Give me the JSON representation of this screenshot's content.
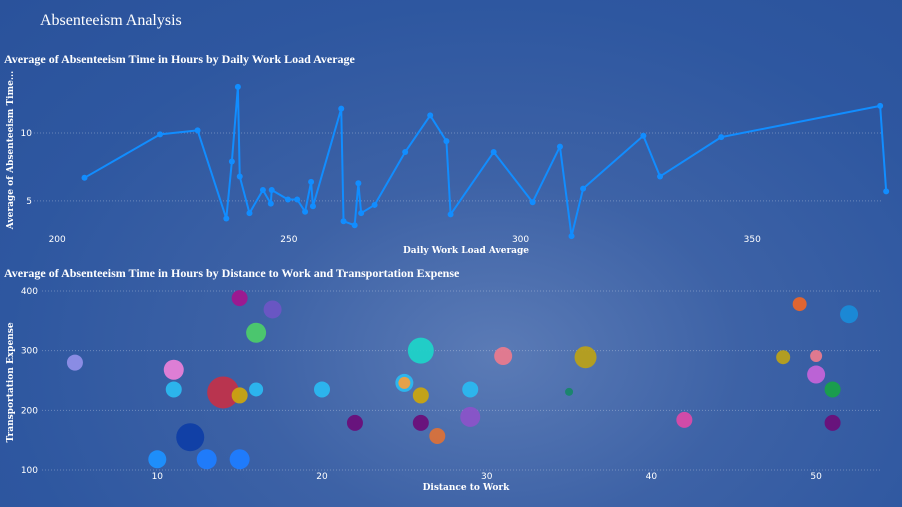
{
  "page": {
    "title": "Absenteeism Analysis"
  },
  "chart_data": [
    {
      "type": "line",
      "title": "Average of Absenteeism Time in Hours by Daily Work Load Average",
      "xlabel": "Daily Work Load Average",
      "ylabel": "Average of Absenteeism Time...",
      "xlim": [
        195,
        378
      ],
      "ylim": [
        3,
        14.5
      ],
      "xticks": [
        200,
        250,
        300,
        350
      ],
      "yticks": [
        5,
        10
      ],
      "color": "#118dff",
      "x": [
        205.9,
        222.2,
        230.3,
        236.5,
        237.7,
        239.0,
        239.4,
        241.5,
        244.4,
        246.1,
        246.3,
        249.8,
        251.8,
        253.5,
        254.8,
        255.2,
        261.3,
        261.8,
        264.2,
        265.0,
        265.6,
        268.5,
        275.1,
        280.5,
        284.0,
        284.9,
        294.2,
        302.6,
        308.5,
        311.0,
        313.5,
        326.5,
        330.1,
        343.3,
        377.6,
        378.9
      ],
      "y": [
        6.7,
        9.9,
        10.2,
        3.7,
        7.9,
        13.4,
        6.8,
        4.1,
        5.8,
        4.8,
        5.8,
        5.1,
        5.1,
        4.2,
        6.4,
        4.6,
        11.8,
        3.5,
        3.2,
        6.3,
        4.1,
        4.7,
        8.6,
        11.3,
        9.4,
        4.0,
        8.6,
        4.9,
        9.0,
        2.4,
        5.9,
        9.8,
        6.8,
        9.7,
        12.0,
        5.7
      ]
    },
    {
      "type": "scatter",
      "title": "Average of Absenteeism Time in Hours by Distance to Work and Transportation Expense",
      "xlabel": "Distance to Work",
      "ylabel": "Transportation Expense",
      "xlim": [
        3,
        54
      ],
      "ylim": [
        85,
        415
      ],
      "xticks": [
        10,
        20,
        30,
        40,
        50
      ],
      "yticks": [
        100,
        200,
        300,
        400
      ],
      "points": [
        {
          "x": 5,
          "y": 280,
          "size": 8,
          "color": "#8f8fe8"
        },
        {
          "x": 10,
          "y": 118,
          "size": 9,
          "color": "#1e90ff"
        },
        {
          "x": 11,
          "y": 268,
          "size": 10,
          "color": "#e67fd8"
        },
        {
          "x": 11,
          "y": 235,
          "size": 8,
          "color": "#2bb8f0"
        },
        {
          "x": 12,
          "y": 155,
          "size": 14,
          "color": "#0f3ea6"
        },
        {
          "x": 13,
          "y": 118,
          "size": 10,
          "color": "#1e7cff"
        },
        {
          "x": 14,
          "y": 230,
          "size": 16,
          "color": "#c0314a"
        },
        {
          "x": 15,
          "y": 388,
          "size": 8,
          "color": "#a0168f"
        },
        {
          "x": 15,
          "y": 225,
          "size": 8,
          "color": "#c9a410"
        },
        {
          "x": 15,
          "y": 118,
          "size": 10,
          "color": "#1e7cff"
        },
        {
          "x": 16,
          "y": 330,
          "size": 10,
          "color": "#4ccb6a"
        },
        {
          "x": 16,
          "y": 235,
          "size": 7,
          "color": "#2bb8f0"
        },
        {
          "x": 17,
          "y": 369,
          "size": 9,
          "color": "#6b55c4"
        },
        {
          "x": 20,
          "y": 235,
          "size": 8,
          "color": "#2bb8f0"
        },
        {
          "x": 22,
          "y": 179,
          "size": 8,
          "color": "#6a0f7a"
        },
        {
          "x": 25,
          "y": 246,
          "size": 9,
          "color": "#2bb8f0"
        },
        {
          "x": 25,
          "y": 246,
          "size": 6,
          "color": "#f0a040"
        },
        {
          "x": 26,
          "y": 300,
          "size": 13,
          "color": "#1fd2c8"
        },
        {
          "x": 26,
          "y": 225,
          "size": 8,
          "color": "#c9a410"
        },
        {
          "x": 26,
          "y": 179,
          "size": 8,
          "color": "#6a0f7a"
        },
        {
          "x": 27,
          "y": 157,
          "size": 8,
          "color": "#d9713a"
        },
        {
          "x": 29,
          "y": 189,
          "size": 10,
          "color": "#8a53c8"
        },
        {
          "x": 29,
          "y": 235,
          "size": 8,
          "color": "#2bb8f0"
        },
        {
          "x": 31,
          "y": 291,
          "size": 9,
          "color": "#e87a8e"
        },
        {
          "x": 35,
          "y": 231,
          "size": 4,
          "color": "#18866a"
        },
        {
          "x": 36,
          "y": 289,
          "size": 11,
          "color": "#b8a01a"
        },
        {
          "x": 42,
          "y": 184,
          "size": 8,
          "color": "#d94aa8"
        },
        {
          "x": 48,
          "y": 289,
          "size": 7,
          "color": "#b8a01a"
        },
        {
          "x": 49,
          "y": 378,
          "size": 7,
          "color": "#e8652a"
        },
        {
          "x": 50,
          "y": 291,
          "size": 6,
          "color": "#e87a8e"
        },
        {
          "x": 50,
          "y": 260,
          "size": 9,
          "color": "#c263d8"
        },
        {
          "x": 51,
          "y": 235,
          "size": 8,
          "color": "#18a04a"
        },
        {
          "x": 51,
          "y": 179,
          "size": 8,
          "color": "#6a0f7a"
        },
        {
          "x": 52,
          "y": 361,
          "size": 9,
          "color": "#1a8ad8"
        }
      ]
    }
  ]
}
